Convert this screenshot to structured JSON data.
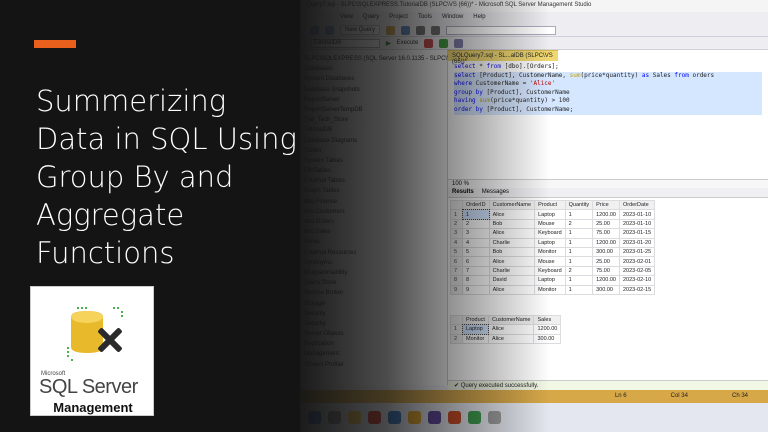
{
  "slide": {
    "title": "Summerizing Data in SQL Using Group By and Aggregate Functions",
    "accent_color": "#e8601c",
    "background_color": "#141414"
  },
  "logo": {
    "vendor": "Microsoft",
    "product": "SQL Server",
    "subtitle": "Management"
  },
  "ssms": {
    "window_title": "Query7.sql - SLPC\\SQLEXPRESS.TutorialDB (SLPC\\VS (66))* - Microsoft SQL Server Management Studio",
    "menu": [
      "View",
      "Query",
      "Project",
      "Tools",
      "Window",
      "Help"
    ],
    "toolbar": {
      "new_query": "New Query",
      "database": "TutorialDB",
      "execute": "Execute"
    },
    "object_explorer": [
      "SLPC\\SQLEXPRESS (SQL Server 16.0.1135 - SLPC\\VS)",
      "Databases",
      "System Databases",
      "Database Snapshots",
      "ReportServer",
      "ReportServerTempDB",
      "The_Tech_Store",
      "TutorialDB",
      "Database Diagrams",
      "Tables",
      "System Tables",
      "FileTables",
      "External Tables",
      "Graph Tables",
      "dbo.Finance",
      "dbo.Customers",
      "dbo.Orders",
      "dbo.Sales",
      "Views",
      "External Resources",
      "Synonyms",
      "Programmability",
      "Query Store",
      "Service Broker",
      "Storage",
      "Security",
      "Security",
      "Server Objects",
      "Replication",
      "Management",
      "XEvent Profiler"
    ],
    "tab_label": "SQLQuery7.sql - SL...alDB (SLPC\\VS (66))*",
    "code": [
      "select * from [dbo].[Orders];",
      "select [Product], CustomerName, sum(price*quantity) as Sales from orders",
      "where CustomerName = 'Alice'",
      "group by [Product], CustomerName",
      "having sum(price*quantity) > 100",
      "order by [Product], CustomerName;"
    ],
    "zoom": "100 %",
    "results_tab": "Results",
    "messages_tab": "Messages",
    "grid1": {
      "columns": [
        "OrderID",
        "CustomerName",
        "Product",
        "Quantity",
        "Price",
        "OrderDate"
      ],
      "rows": [
        [
          "1",
          "1",
          "Alice",
          "Laptop",
          "1",
          "1200.00",
          "2023-01-10"
        ],
        [
          "2",
          "2",
          "Bob",
          "Mouse",
          "2",
          "25.00",
          "2023-01-10"
        ],
        [
          "3",
          "3",
          "Alice",
          "Keyboard",
          "1",
          "75.00",
          "2023-01-15"
        ],
        [
          "4",
          "4",
          "Charlie",
          "Laptop",
          "1",
          "1200.00",
          "2023-01-20"
        ],
        [
          "5",
          "5",
          "Bob",
          "Monitor",
          "1",
          "300.00",
          "2023-01-25"
        ],
        [
          "6",
          "6",
          "Alice",
          "Mouse",
          "1",
          "25.00",
          "2023-02-01"
        ],
        [
          "7",
          "7",
          "Charlie",
          "Keyboard",
          "2",
          "75.00",
          "2023-02-05"
        ],
        [
          "8",
          "8",
          "David",
          "Laptop",
          "1",
          "1200.00",
          "2023-02-10"
        ],
        [
          "9",
          "9",
          "Alice",
          "Monitor",
          "1",
          "300.00",
          "2023-02-15"
        ]
      ]
    },
    "grid2": {
      "columns": [
        "Product",
        "CustomerName",
        "Sales"
      ],
      "rows": [
        [
          "1",
          "Laptop",
          "Alice",
          "1200.00"
        ],
        [
          "2",
          "Monitor",
          "Alice",
          "300.00"
        ]
      ]
    },
    "status_message": "Query executed successfully.",
    "status_ln": "Ln 6",
    "status_col": "Col 34",
    "status_ch": "Ch 34"
  }
}
